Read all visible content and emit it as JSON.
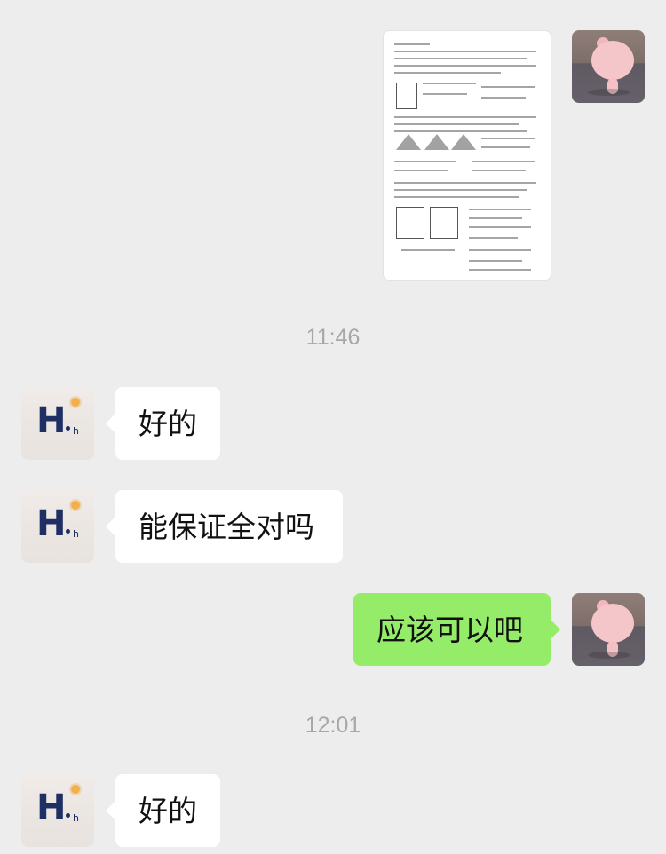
{
  "chat": {
    "messages": [
      {
        "id": "m1",
        "sender": "me",
        "type": "image",
        "image_name": "worksheet-photo"
      },
      {
        "id": "t1",
        "type": "timestamp",
        "text": "11:46"
      },
      {
        "id": "m2",
        "sender": "other",
        "type": "text",
        "text": "好的"
      },
      {
        "id": "m3",
        "sender": "other",
        "type": "text",
        "text": "能保证全对吗"
      },
      {
        "id": "m4",
        "sender": "me",
        "type": "text",
        "text": "应该可以吧"
      },
      {
        "id": "t2",
        "type": "timestamp",
        "text": "12:01"
      },
      {
        "id": "m5",
        "sender": "other",
        "type": "text",
        "text": "好的"
      }
    ]
  },
  "avatars": {
    "other": {
      "letter": "H",
      "suffix": "h",
      "icon": "sun-icon"
    },
    "me": {
      "icon": "pig-icon"
    }
  },
  "colors": {
    "background": "#ededed",
    "bubble_self": "#95ec69",
    "bubble_other": "#ffffff",
    "timestamp": "#a7a7a7",
    "avatar_letter": "#1f2f63"
  }
}
